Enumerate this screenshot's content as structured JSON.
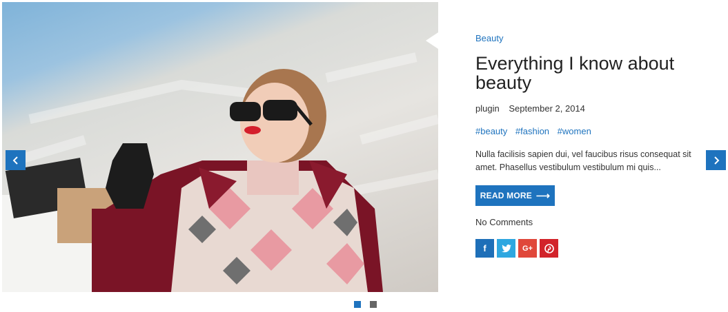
{
  "post": {
    "category": "Beauty",
    "title": "Everything I know about beauty",
    "author": "plugin",
    "date": "September 2, 2014",
    "tags": [
      "#beauty",
      "#fashion",
      "#women"
    ],
    "excerpt": "Nulla facilisis sapien dui, vel faucibus risus consequat sit amet. Phasellus vestibulum vestibulum mi quis...",
    "read_more": "READ MORE",
    "comments": "No Comments"
  },
  "share": {
    "facebook": "f",
    "twitter": "t",
    "googleplus": "G+",
    "pinterest": "p"
  },
  "slider": {
    "slide_count": 2,
    "active_slide": 1
  },
  "colors": {
    "accent": "#1e73be",
    "facebook": "#1e6fb8",
    "twitter": "#2ea7e0",
    "googleplus": "#e0473a",
    "pinterest": "#d2232a"
  }
}
